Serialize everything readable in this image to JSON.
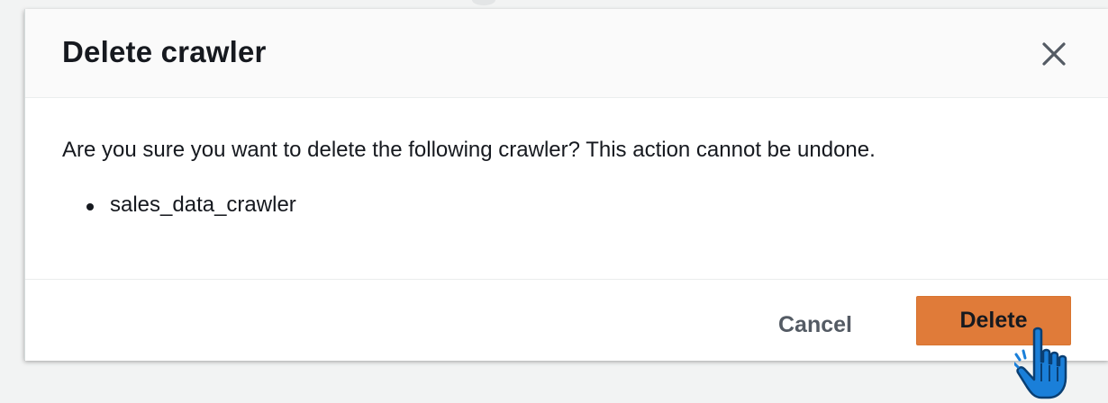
{
  "dialog": {
    "title": "Delete crawler",
    "message": "Are you sure you want to delete the following crawler? This action cannot be undone.",
    "items": [
      "sales_data_crawler"
    ],
    "cancel_label": "Cancel",
    "delete_label": "Delete"
  },
  "icons": {
    "close": "close-icon",
    "cursor": "hand-pointer-icon"
  },
  "colors": {
    "primary_button": "#e07b39",
    "header_bg": "#fafafa",
    "text": "#16191f",
    "secondary_text": "#545b64",
    "cursor": "#1a7fd9"
  }
}
